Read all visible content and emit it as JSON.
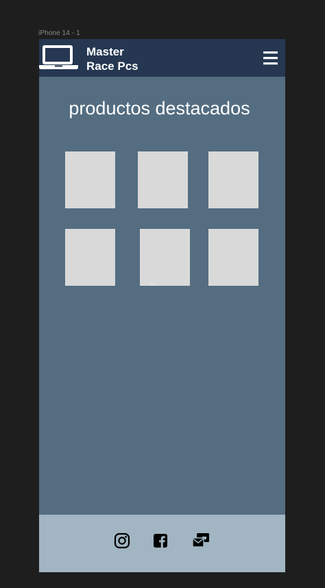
{
  "canvas": {
    "frame_label": "iPhone 14 - 1"
  },
  "header": {
    "brand_line1": "Master",
    "brand_line2": "Race Pcs",
    "logo_icon": "laptop-icon",
    "menu_icon": "hamburger-menu-icon"
  },
  "main": {
    "title": "productos destacados",
    "products": [
      {
        "name": "product-1"
      },
      {
        "name": "product-2"
      },
      {
        "name": "product-3"
      },
      {
        "name": "product-4"
      },
      {
        "name": "product-5"
      },
      {
        "name": "product-6"
      }
    ]
  },
  "footer": {
    "icons": [
      "instagram-icon",
      "facebook-icon",
      "mail-icon"
    ]
  },
  "colors": {
    "canvas_bg": "#1e1e1e",
    "header_bg": "#253751",
    "main_bg": "#546d81",
    "tile_bg": "#d9d9d9",
    "footer_bg": "#a1b5c2",
    "text_light": "#ffffff",
    "icon_dark": "#000000"
  }
}
